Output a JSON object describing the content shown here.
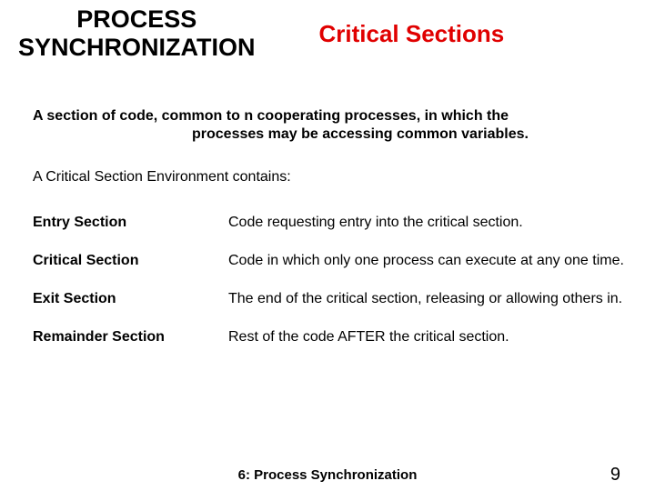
{
  "header": {
    "left": "PROCESS\nSYNCHRONIZATION",
    "right": "Critical Sections"
  },
  "definition": {
    "line1": "A section of code, common to n cooperating processes, in which the",
    "line2": "processes may be accessing common variables."
  },
  "env_intro": "A Critical Section Environment contains:",
  "sections": [
    {
      "term": "Entry Section",
      "desc": "Code requesting entry into the critical section."
    },
    {
      "term": "Critical Section",
      "desc": "Code in which only one process can execute at any one time."
    },
    {
      "term": "Exit Section",
      "desc": "The end of the critical section, releasing or allowing others in."
    },
    {
      "term": "Remainder Section",
      "desc": "Rest of the code AFTER the critical section."
    }
  ],
  "footer": {
    "title": "6: Process Synchronization",
    "page": "9"
  }
}
